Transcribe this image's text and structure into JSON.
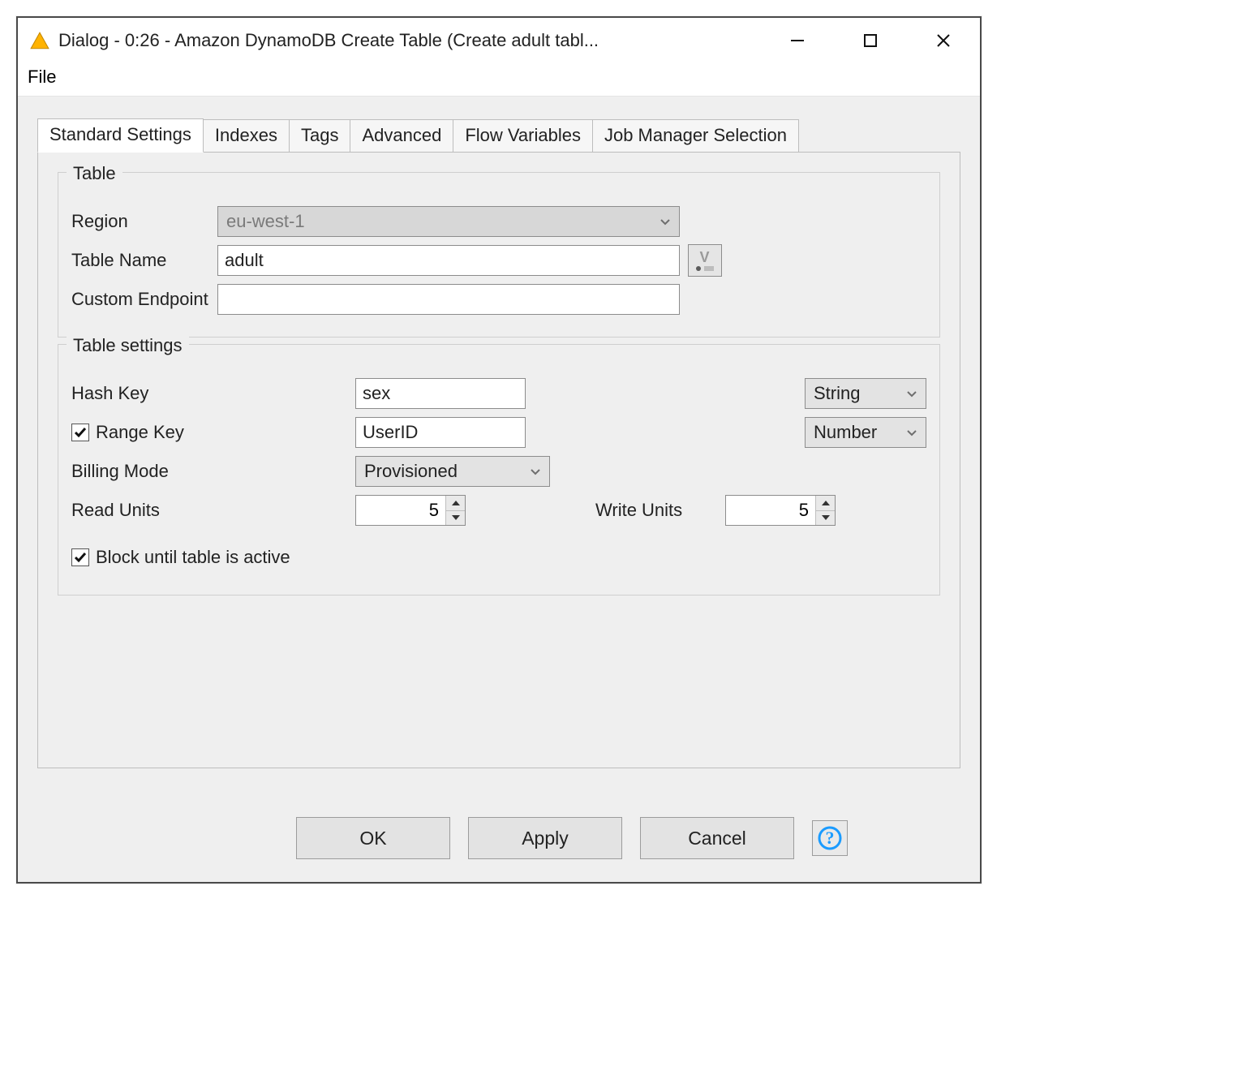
{
  "window": {
    "title": "Dialog - 0:26 - Amazon DynamoDB Create Table (Create adult  tabl..."
  },
  "menu": {
    "file": "File"
  },
  "tabs": {
    "standard": "Standard Settings",
    "indexes": "Indexes",
    "tags": "Tags",
    "advanced": "Advanced",
    "flowvars": "Flow Variables",
    "jobmgr": "Job Manager Selection"
  },
  "groups": {
    "table": "Table",
    "settings": "Table settings"
  },
  "table": {
    "region_label": "Region",
    "region_value": "eu-west-1",
    "name_label": "Table Name",
    "name_value": "adult",
    "endpoint_label": "Custom Endpoint",
    "endpoint_value": ""
  },
  "settings": {
    "hash_label": "Hash Key",
    "hash_value": "sex",
    "hash_type": "String",
    "range_label": "Range Key",
    "range_checked": true,
    "range_value": "UserID",
    "range_type": "Number",
    "billing_label": "Billing Mode",
    "billing_value": "Provisioned",
    "read_label": "Read Units",
    "read_value": "5",
    "write_label": "Write Units",
    "write_value": "5",
    "block_label": "Block until table is active",
    "block_checked": true
  },
  "buttons": {
    "ok": "OK",
    "apply": "Apply",
    "cancel": "Cancel"
  }
}
